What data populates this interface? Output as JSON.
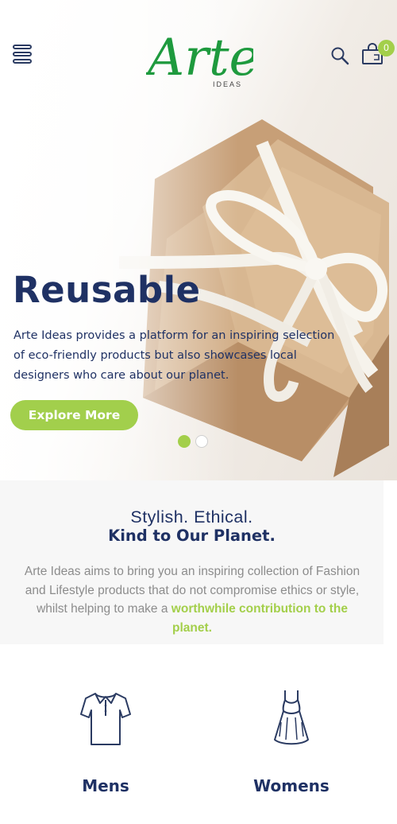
{
  "header": {
    "logo_text": "Arte",
    "logo_subtext": "IDEAS",
    "cart_count": "0",
    "icons": [
      "menu-icon",
      "search-icon",
      "cart-icon"
    ]
  },
  "hero": {
    "title": "Reusable",
    "text": "Arte Ideas provides a platform for an inspiring selection of eco-friendly products but also showcases local designers who care about our planet.",
    "button_label": "Explore More",
    "slides_total": 2,
    "active_slide": 1
  },
  "intro": {
    "heading": "Stylish. Ethical.",
    "subheading": "Kind to Our Planet.",
    "paragraph": "Arte Ideas aims to bring you an inspiring collection of Fashion and Lifestyle products that do not compromise ethics or style, whilst helping to make a",
    "highlight": "worthwhile contribution to the planet."
  },
  "categories": [
    {
      "label": "Mens",
      "icon": "shirt-icon"
    },
    {
      "label": "Womens",
      "icon": "dress-icon"
    }
  ],
  "colors": {
    "brand_green": "#a3cf4a",
    "logo_green": "#1e9a3e",
    "navy": "#1f3164",
    "muted_text": "#8c8c8c"
  }
}
